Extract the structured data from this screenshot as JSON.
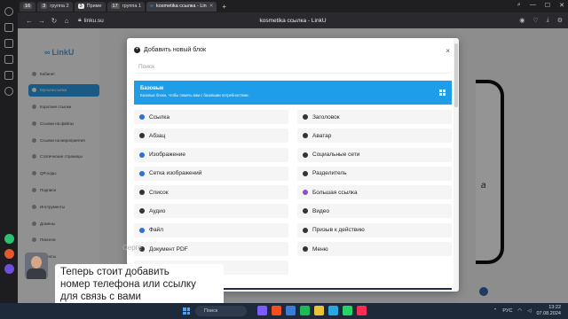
{
  "browser": {
    "tabs": [
      {
        "badge": "16",
        "label": ""
      },
      {
        "badge": "3",
        "label": "группа 2"
      },
      {
        "badge": "3",
        "label": "Приме"
      },
      {
        "badge": "17",
        "label": "группа 1"
      },
      {
        "badge": "",
        "label": "kosmetika ссылка - Lin"
      }
    ],
    "url": "linku.su",
    "page_title": "kosmetika ссылка - LinkU",
    "tab_count_badge": "37"
  },
  "app": {
    "logo": "LinkU",
    "nav": [
      "Кабинет",
      "Мультиссылки",
      "Короткие ссылки",
      "Ссылки на файлы",
      "Ссылки на мероприятия",
      "Статические страницы",
      "QR-коды",
      "Подписи",
      "Инструменты",
      "Домены",
      "Пиксели",
      "Проекты"
    ],
    "active_nav": 1,
    "preview_text": "a"
  },
  "modal": {
    "title": "Добавить новый блок",
    "close": "×",
    "search_placeholder": "Поиск",
    "banner": {
      "title": "Базовые",
      "description": "Базовые блоки, чтобы помочь вам с базовыми потребностями."
    },
    "blocks_left": [
      {
        "label": "Ссылка",
        "color": "blue"
      },
      {
        "label": "Абзац",
        "color": "dark"
      },
      {
        "label": "Изображение",
        "color": "blue"
      },
      {
        "label": "Сетка изображений",
        "color": "blue"
      },
      {
        "label": "Список",
        "color": "dark"
      },
      {
        "label": "Аудио",
        "color": "dark"
      },
      {
        "label": "Файл",
        "color": "blue"
      },
      {
        "label": "Документ PDF",
        "color": "dark"
      },
      {
        "label": "Блок со ставками",
        "color": "faded"
      }
    ],
    "blocks_right": [
      {
        "label": "Заголовок",
        "color": "dark"
      },
      {
        "label": "Аватар",
        "color": "dark"
      },
      {
        "label": "Социальные сети",
        "color": "dark"
      },
      {
        "label": "Разделитель",
        "color": "dark"
      },
      {
        "label": "Большая ссылка",
        "color": "purple"
      },
      {
        "label": "Видео",
        "color": "dark"
      },
      {
        "label": "Призыв к действию",
        "color": "dark"
      },
      {
        "label": "Меню",
        "color": "dark"
      }
    ]
  },
  "video_overlay": {
    "name": "Серге",
    "caption_lines": [
      "Теперь стоит добавить",
      "номер телефона или ссылку",
      "для связь с вами"
    ]
  },
  "taskbar": {
    "search_placeholder": "Поиск",
    "lang": "РУС",
    "time": "13:22",
    "date": "07.08.2024"
  }
}
